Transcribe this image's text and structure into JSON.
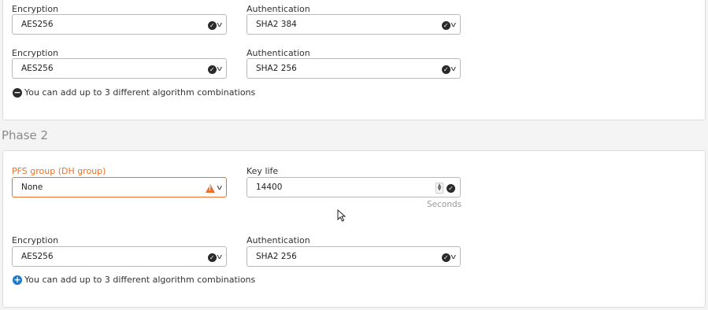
{
  "phase1": {
    "rows": [
      {
        "encryption_label": "Encryption",
        "encryption_value": "AES256",
        "authentication_label": "Authentication",
        "authentication_value": "SHA2 384"
      },
      {
        "encryption_label": "Encryption",
        "encryption_value": "AES256",
        "authentication_label": "Authentication",
        "authentication_value": "SHA2 256"
      }
    ],
    "hint": "You can add up to 3 different algorithm combinations"
  },
  "phase2": {
    "title": "Phase 2",
    "pfs_label": "PFS group (DH group)",
    "pfs_value": "None",
    "keylife_label": "Key life",
    "keylife_value": "14400",
    "keylife_unit": "Seconds",
    "encryption_label": "Encryption",
    "encryption_value": "AES256",
    "authentication_label": "Authentication",
    "authentication_value": "SHA2 256",
    "hint": "You can add up to 3 different algorithm combinations"
  },
  "colors": {
    "warning": "#e8712b",
    "add_icon": "#1f77c8"
  }
}
